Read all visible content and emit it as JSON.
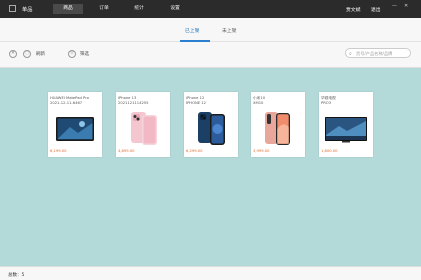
{
  "topbar": {
    "brand": "单品",
    "nav": [
      {
        "label": "商品",
        "active": true
      },
      {
        "label": "订单",
        "active": false
      },
      {
        "label": "统计",
        "active": false
      },
      {
        "label": "设置",
        "active": false
      }
    ],
    "user": "贾文斌",
    "logout": "退出"
  },
  "tabs": {
    "on_shelf": "已上架",
    "off_shelf": "未上架"
  },
  "toolbar": {
    "refresh_label": "刷新",
    "filter_label": "筛选",
    "search_placeholder": "货号/产品名称/品牌"
  },
  "products": [
    {
      "name_line1": "HUAWEI MatePad Pro",
      "name_line2": "2021-12-11-6467",
      "price": "6,199.00",
      "image": "tablet"
    },
    {
      "name_line1": "iPhone 13",
      "name_line2": "2021121114255",
      "price": "4,899.00",
      "image": "iphone-pink"
    },
    {
      "name_line1": "iPhone 12",
      "name_line2": "IPHONE 12",
      "price": "6,299.00",
      "image": "iphone-blue"
    },
    {
      "name_line1": "小米10",
      "name_line2": "XM10",
      "price": "3,999.00",
      "image": "xiaomi-pink"
    },
    {
      "name_line1": "华硕电视",
      "name_line2": "PRO3",
      "price": "1,800.00",
      "image": "tv"
    }
  ],
  "footer": {
    "count_label": "总数：",
    "count_value": "5"
  },
  "colors": {
    "topbar_bg": "#2b2b2b",
    "content_bg": "#b3d9d9",
    "accent": "#2b7fd0",
    "price": "#e06b2c"
  }
}
